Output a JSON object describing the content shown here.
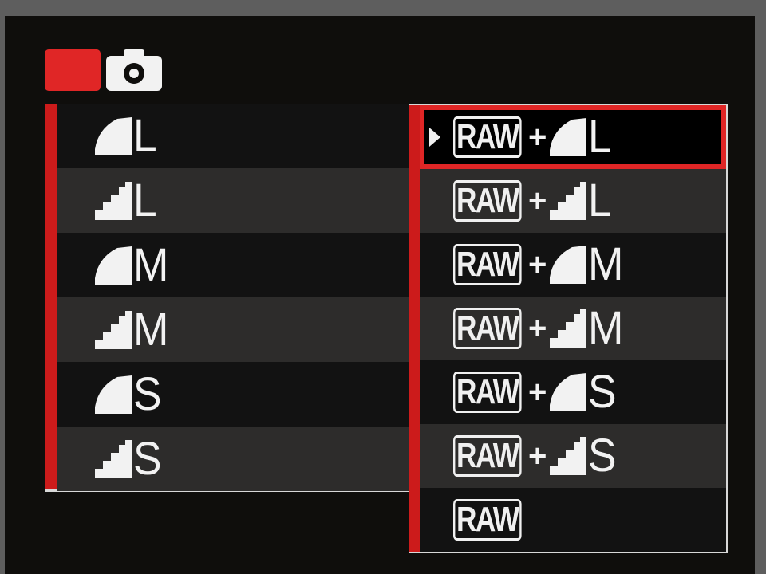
{
  "tabs": [
    {
      "name": "shooting-menu-tab-active",
      "icon": "red-tab-marker"
    },
    {
      "name": "camera-tab",
      "icon": "camera-icon"
    }
  ],
  "left_menu": [
    {
      "icon": "fine-quality-icon",
      "size": "L"
    },
    {
      "icon": "normal-quality-icon",
      "size": "L"
    },
    {
      "icon": "fine-quality-icon",
      "size": "M"
    },
    {
      "icon": "normal-quality-icon",
      "size": "M"
    },
    {
      "icon": "fine-quality-icon",
      "size": "S"
    },
    {
      "icon": "normal-quality-icon",
      "size": "S"
    }
  ],
  "right_menu": [
    {
      "raw": "RAW",
      "plus": "+",
      "icon": "fine-quality-icon",
      "size": "L",
      "selected": true
    },
    {
      "raw": "RAW",
      "plus": "+",
      "icon": "normal-quality-icon",
      "size": "L"
    },
    {
      "raw": "RAW",
      "plus": "+",
      "icon": "fine-quality-icon",
      "size": "M"
    },
    {
      "raw": "RAW",
      "plus": "+",
      "icon": "normal-quality-icon",
      "size": "M"
    },
    {
      "raw": "RAW",
      "plus": "+",
      "icon": "fine-quality-icon",
      "size": "S"
    },
    {
      "raw": "RAW",
      "plus": "+",
      "icon": "normal-quality-icon",
      "size": "S"
    },
    {
      "raw": "RAW"
    }
  ],
  "colors": {
    "accent": "#e02626",
    "text": "#f2f2f2",
    "row_alt": "#2d2c2b",
    "background": "#0f0e0c"
  }
}
